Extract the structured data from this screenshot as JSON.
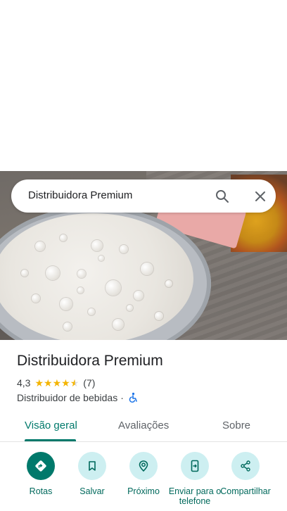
{
  "search": {
    "query": "Distribuidora Premium"
  },
  "place": {
    "title": "Distribuidora Premium",
    "rating": "4,3",
    "stars": 4.3,
    "review_count": "(7)",
    "category": "Distribuidor de bebidas",
    "separator": "·"
  },
  "tabs": [
    {
      "label": "Visão geral",
      "active": true
    },
    {
      "label": "Avaliações",
      "active": false
    },
    {
      "label": "Sobre",
      "active": false
    }
  ],
  "actions": [
    {
      "label": "Rotas",
      "icon": "directions-icon"
    },
    {
      "label": "Salvar",
      "icon": "bookmark-icon"
    },
    {
      "label": "Próximo",
      "icon": "nearby-icon"
    },
    {
      "label": "Enviar para o telefone",
      "icon": "send-to-phone-icon"
    },
    {
      "label": "Compartilhar",
      "icon": "share-icon"
    }
  ],
  "colors": {
    "accent": "#00796b",
    "action_bg": "#cdeff1",
    "star": "#f4b400"
  }
}
